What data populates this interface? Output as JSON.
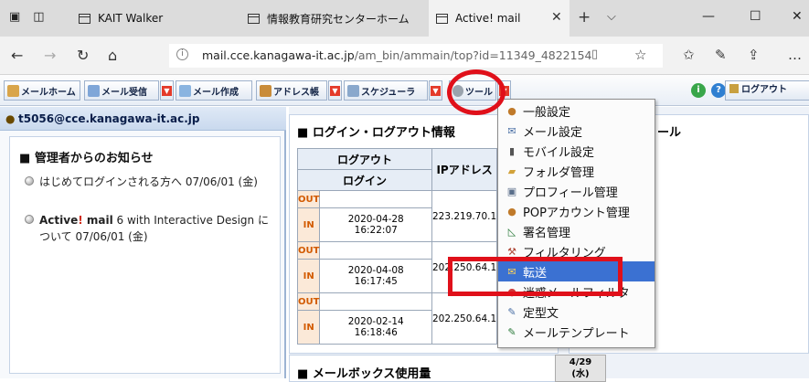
{
  "browser": {
    "tabs": [
      {
        "label": "KAIT Walker"
      },
      {
        "label": "情報教育研究センターホーム"
      },
      {
        "label": "Active! mail"
      }
    ],
    "url_host": "mail.cce.kanagawa-it.ac.jp",
    "url_path": "/am_bin/ammain/top?id=11349_4822154"
  },
  "toolbar": {
    "home": "メールホーム",
    "inbox": "メール受信",
    "compose": "メール作成",
    "addressbook": "アドレス帳",
    "scheduler": "スケジューラ",
    "tools": "ツール",
    "logout": "ログアウト"
  },
  "user": {
    "email": "t5056@cce.kanagawa-it.ac.jp"
  },
  "notices": {
    "title": "管理者からのお知らせ",
    "items": [
      {
        "text": "はじめてログインされる方へ 07/06/01 (金)"
      },
      {
        "brand_a": "Active",
        "brand_b": "!",
        "brand_c": " mail",
        "text": " 6 with Interactive Design について 07/06/01 (金)"
      }
    ]
  },
  "login_panel": {
    "title": "ログイン・ログアウト情報",
    "col_logout": "ログアウト",
    "col_login": "ログイン",
    "col_ip": "IPアドレス",
    "out_label": "OUT",
    "in_label": "IN",
    "rows": [
      {
        "date": "2020-04-28",
        "time": "16:22:07",
        "ip": "223.219.70.1"
      },
      {
        "date": "2020-04-08",
        "time": "16:17:45",
        "ip": "202.250.64.1"
      },
      {
        "date": "2020-02-14",
        "time": "16:18:46",
        "ip": "202.250.64.1"
      }
    ]
  },
  "mailbox_panel": {
    "title": "メールボックス使用量"
  },
  "right_panel": {
    "title_fragment": "ール"
  },
  "calendar": {
    "date": "4/29",
    "weekday": "(水)"
  },
  "tools_menu": {
    "items": [
      {
        "label": "一般設定",
        "icon": "settings-icon"
      },
      {
        "label": "メール設定",
        "icon": "mail-settings-icon"
      },
      {
        "label": "モバイル設定",
        "icon": "mobile-icon"
      },
      {
        "label": "フォルダ管理",
        "icon": "folder-icon"
      },
      {
        "label": "プロフィール管理",
        "icon": "profile-icon"
      },
      {
        "label": "POPアカウント管理",
        "icon": "pop-account-icon"
      },
      {
        "label": "署名管理",
        "icon": "signature-icon"
      },
      {
        "label": "フィルタリング",
        "icon": "filter-icon"
      },
      {
        "label": "転送",
        "icon": "forward-icon"
      },
      {
        "label": "迷惑メールフィルタ",
        "icon": "spam-filter-icon"
      },
      {
        "label": "定型文",
        "icon": "template-text-icon"
      },
      {
        "label": "メールテンプレート",
        "icon": "mail-template-icon"
      }
    ],
    "highlighted": "転送"
  },
  "colors": {
    "highlight": "#3b71d2",
    "annotation": "#e0101a",
    "dropdown_arrow": "#e43a2a"
  }
}
